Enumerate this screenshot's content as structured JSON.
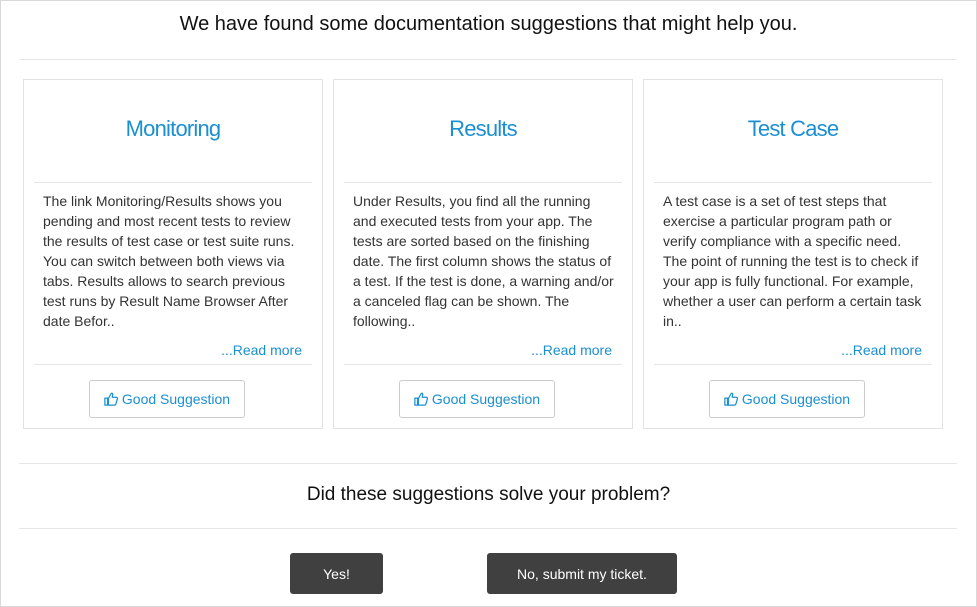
{
  "header": {
    "title": "We have found some documentation suggestions that might help you."
  },
  "cards": [
    {
      "title": "Monitoring",
      "body": "The link Monitoring/Results shows you pending and most recent tests to review the results of test case or test suite runs. You can switch between both views via tabs. Results allows to search previous test runs by Result Name Browser After date Befor..",
      "read_more": "...Read more",
      "button_label": "Good Suggestion",
      "button_icon": "thumbs-up-icon"
    },
    {
      "title": "Results",
      "body": "Under Results, you find all the running and executed tests from your app. The tests are sorted based on the finishing date. The first column shows the status of a test. If the test is done, a warning and/or a canceled flag can be shown. The following..",
      "read_more": "...Read more",
      "button_label": "Good Suggestion",
      "button_icon": "thumbs-up-icon"
    },
    {
      "title": "Test Case",
      "body": "A test case is a set of test steps that exercise a particular program path or verify compliance with a specific need. The point of running the test is to check if your app is fully functional. For example, whether a user can perform a certain task in..",
      "read_more": "...Read more",
      "button_label": "Good Suggestion",
      "button_icon": "thumbs-up-icon"
    }
  ],
  "feedback": {
    "question": "Did these suggestions solve your problem?",
    "yes_label": "Yes!",
    "no_label": "No, submit my ticket."
  },
  "colors": {
    "accent": "#1a8fd1",
    "dark_button": "#404040",
    "border": "#e2e2e2"
  }
}
